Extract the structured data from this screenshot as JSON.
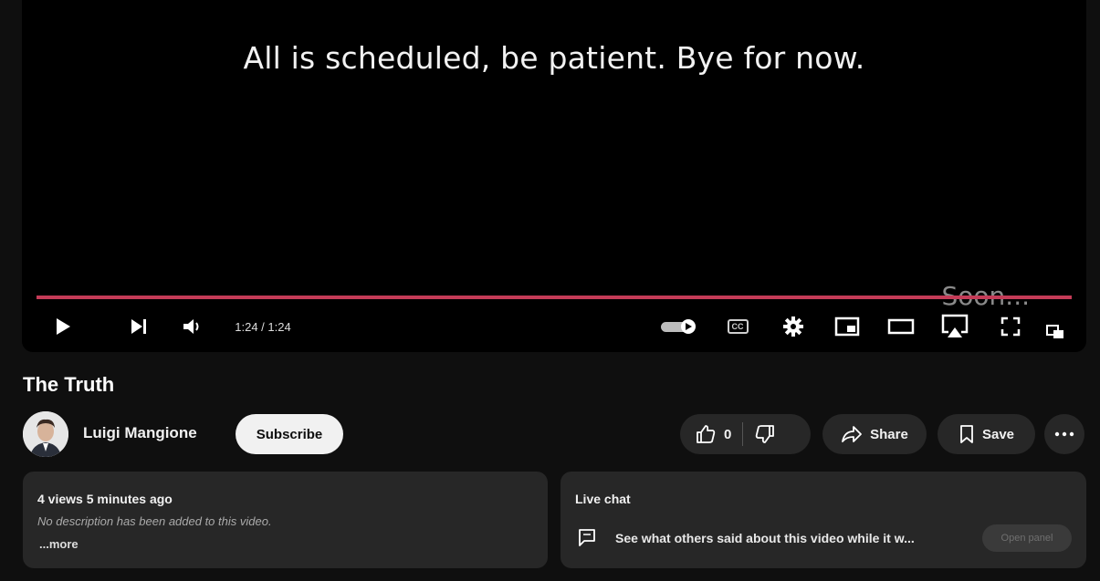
{
  "player": {
    "caption": "All is scheduled, be patient. Bye for now.",
    "overlay_text": "Soon...",
    "time_display": "1:24 / 1:24",
    "progress": 1.0,
    "progress_color": "#c43b57",
    "icons": [
      "play-icon",
      "next-icon",
      "volume-icon",
      "autoplay-toggle",
      "subtitles-icon",
      "settings-icon",
      "miniplayer-icon",
      "theater-icon",
      "airplay-icon",
      "fullscreen-icon",
      "cast-icon"
    ],
    "cc_label": "CC"
  },
  "video": {
    "title": "The Truth",
    "channel": "Luigi Mangione",
    "subscribe_label": "Subscribe",
    "likes": "0",
    "share_label": "Share",
    "save_label": "Save"
  },
  "description": {
    "meta": "4 views  5 minutes ago",
    "text": "No description has been added to this video.",
    "more": "...more"
  },
  "live_chat": {
    "title": "Live chat",
    "prompt": "See what others said about this video while it w...",
    "open_panel_label": "Open panel"
  }
}
